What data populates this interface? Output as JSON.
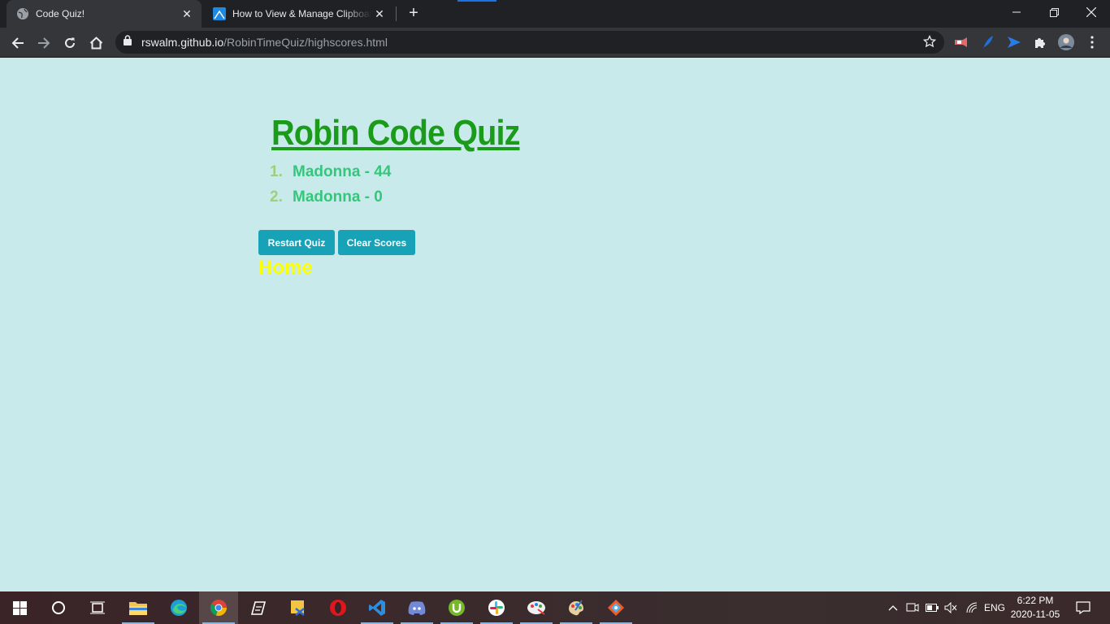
{
  "browser": {
    "tabs": [
      {
        "title": "Code Quiz!",
        "active": true
      },
      {
        "title": "How to View & Manage Clipboard",
        "active": false
      }
    ],
    "url_domain": "rswalm.github.io",
    "url_path": "/RobinTimeQuiz/highscores.html"
  },
  "page": {
    "title": "Robin Code Quiz",
    "scores": [
      {
        "num": "1.",
        "text": "Madonna - 44"
      },
      {
        "num": "2.",
        "text": "Madonna - 0"
      }
    ],
    "restart_label": "Restart Quiz",
    "clear_label": "Clear Scores",
    "home_label": "Home"
  },
  "taskbar": {
    "lang": "ENG",
    "time": "6:22 PM",
    "date": "2020-11-05"
  },
  "colors": {
    "page_bg": "#c8eaea",
    "title": "#1a9b1a",
    "score_text": "#34c77b",
    "button_bg": "#17a2b8",
    "home_link": "#ffff00"
  }
}
